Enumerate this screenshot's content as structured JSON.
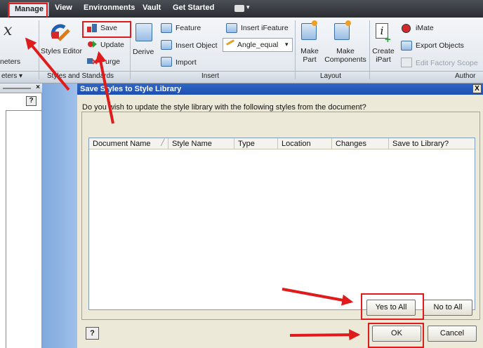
{
  "menu": {
    "items": [
      "Manage",
      "View",
      "Environments",
      "Vault",
      "Get Started"
    ]
  },
  "ribbon": {
    "parameters_label": "neters",
    "parameters_dropdown": "eters",
    "styles_editor_label": "Styles Editor",
    "save_label": "Save",
    "update_label": "Update",
    "purge_label": "Purge",
    "styles_panel_label": "Styles and Standards",
    "derive_label": "Derive",
    "feature_label": "Feature",
    "insert_object_label": "Insert Object",
    "import_label": "Import",
    "insert_ifeature_label": "Insert iFeature",
    "angle_dropdown_value": "Angle_equal",
    "insert_panel_label": "Insert",
    "make_part_label": "Make\nPart",
    "make_components_label": "Make\nComponents",
    "layout_panel_label": "Layout",
    "create_ipart_label": "Create\niPart",
    "imate_label": "iMate",
    "export_objects_label": "Export Objects",
    "edit_factory_scope_label": "Edit Factory Scope",
    "author_panel_label": "Author"
  },
  "side_panel": {
    "close_glyph": "×",
    "help_glyph": "?"
  },
  "dialog": {
    "title": "Save Styles to Style Library",
    "close_glyph": "X",
    "question": "Do you wish to update the style library with the following styles from the document?",
    "columns": [
      "Document Name",
      "Style Name",
      "Type",
      "Location",
      "Changes",
      "Save to Library?"
    ],
    "yes_to_all": "Yes to All",
    "no_to_all": "No to All",
    "ok": "OK",
    "cancel": "Cancel",
    "help_glyph": "?"
  },
  "colors": {
    "annotation": "#e01b1b",
    "titlebar": "#2f66c7",
    "menubar": "#2b2e33"
  }
}
